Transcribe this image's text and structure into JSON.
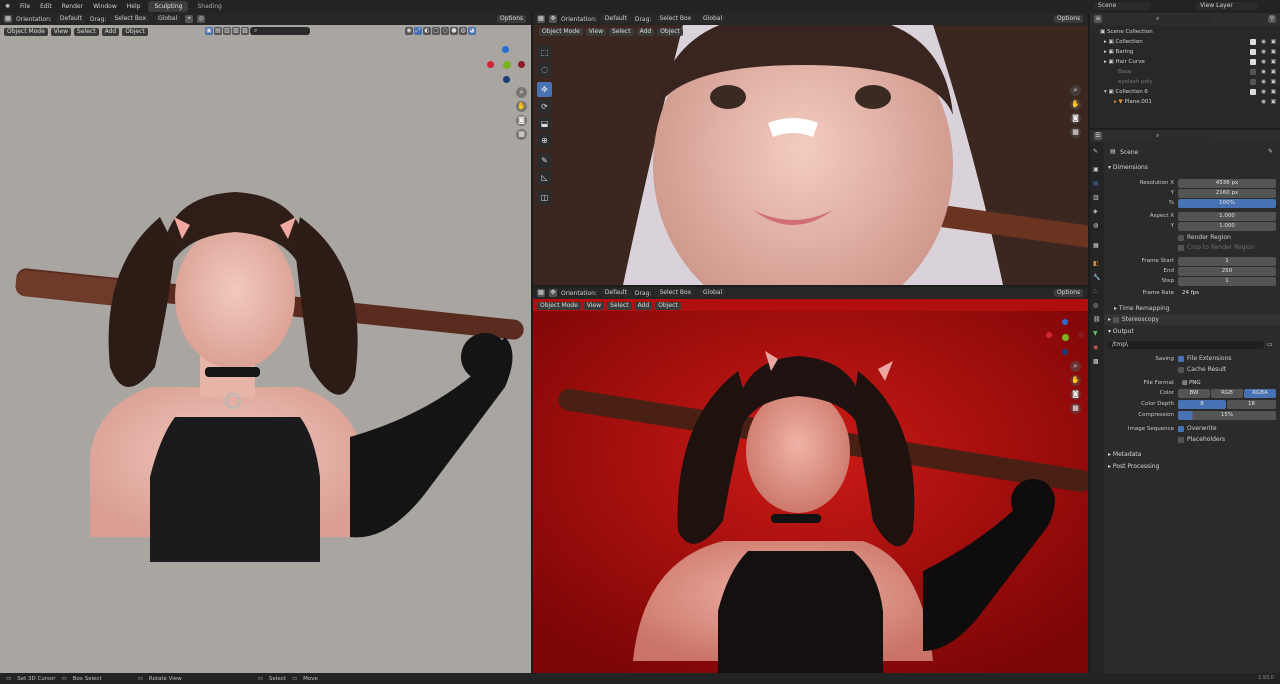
{
  "topbar": {
    "menus": [
      "File",
      "Edit",
      "Render",
      "Window",
      "Help"
    ],
    "workspaces": [
      {
        "label": "Sculpting",
        "active": true
      },
      {
        "label": "Shading",
        "active": false
      }
    ],
    "scene": "Scene",
    "view_layer": "View Layer"
  },
  "viewport_header": {
    "orientation_label": "Orientation:",
    "orientation_value": "Default",
    "drag_label": "Drag:",
    "drag_value": "Select Box",
    "transform_value": "Global",
    "options_label": "Options",
    "mode": "Object Mode",
    "view": "View",
    "select": "Select",
    "add": "Add",
    "object": "Object"
  },
  "outliner": {
    "rows": [
      {
        "label": "Scene Collection",
        "indent": 0
      },
      {
        "label": "Collection",
        "indent": 1
      },
      {
        "label": "Baring",
        "indent": 1
      },
      {
        "label": "Hair Curve",
        "indent": 1
      },
      {
        "label": "Base",
        "indent": 1
      },
      {
        "label": "eyelash poly",
        "indent": 1
      },
      {
        "label": "Collection 6",
        "indent": 1
      },
      {
        "label": "Plane.001",
        "indent": 2
      }
    ]
  },
  "properties": {
    "scene_name": "Scene",
    "dimensions_title": "Dimensions",
    "resolution_x_label": "Resolution X",
    "resolution_x": "4536 px",
    "y_label": "Y",
    "resolution_y": "2160 px",
    "percent_label": "%",
    "percent": "100%",
    "aspect_x_label": "Aspect X",
    "aspect_x": "1.000",
    "aspect_y": "1.000",
    "render_region": "Render Region",
    "crop_region": "Crop to Render Region",
    "frame_start_label": "Frame Start",
    "frame_start": "1",
    "end_label": "End",
    "frame_end": "250",
    "step_label": "Step",
    "frame_step": "1",
    "frame_rate_label": "Frame Rate",
    "frame_rate": "24 fps",
    "time_remapping": "Time Remapping",
    "stereoscopy": "Stereoscopy",
    "output_title": "Output",
    "output_path": "/tmp\\",
    "saving_label": "Saving",
    "file_extensions": "File Extensions",
    "cache_result": "Cache Result",
    "file_format_label": "File Format",
    "file_format": "PNG",
    "color_label": "Color",
    "color_options": [
      "BW",
      "RGB",
      "RGBA"
    ],
    "color_depth_label": "Color Depth",
    "color_depth_options": [
      "8",
      "16"
    ],
    "compression_label": "Compression",
    "compression": "15%",
    "image_sequence_label": "Image Sequence",
    "overwrite": "Overwrite",
    "placeholders": "Placeholders",
    "metadata": "Metadata",
    "post_processing": "Post Processing"
  },
  "statusbar": {
    "items": [
      "Set 3D Cursor",
      "Box Select",
      "Rotate View",
      "Select",
      "Move"
    ],
    "version": "2.93.0"
  },
  "colors": {
    "accent": "#4772b3",
    "left_bg": "#a9a5a1",
    "red_bg": "#b10f0f"
  }
}
